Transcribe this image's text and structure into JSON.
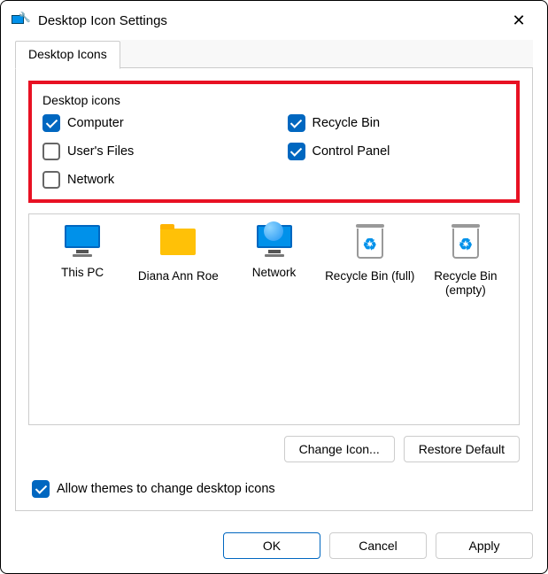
{
  "window": {
    "title": "Desktop Icon Settings"
  },
  "tabs": {
    "main": "Desktop Icons"
  },
  "group": {
    "legend": "Desktop icons",
    "items": [
      {
        "label": "Computer",
        "checked": true
      },
      {
        "label": "Recycle Bin",
        "checked": true
      },
      {
        "label": "User's Files",
        "checked": false
      },
      {
        "label": "Control Panel",
        "checked": true
      },
      {
        "label": "Network",
        "checked": false
      }
    ]
  },
  "iconlist": [
    {
      "label": "This PC",
      "icon": "monitor"
    },
    {
      "label": "Diana Ann Roe",
      "icon": "folder"
    },
    {
      "label": "Network",
      "icon": "net-monitor"
    },
    {
      "label": "Recycle Bin (full)",
      "icon": "bin"
    },
    {
      "label": "Recycle Bin (empty)",
      "icon": "bin"
    }
  ],
  "buttons": {
    "change_icon": "Change Icon...",
    "restore_default": "Restore Default",
    "ok": "OK",
    "cancel": "Cancel",
    "apply": "Apply"
  },
  "allow_themes": {
    "label": "Allow themes to change desktop icons",
    "checked": true
  }
}
